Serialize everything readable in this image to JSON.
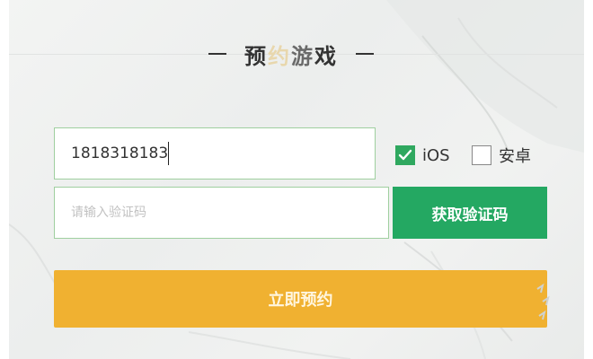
{
  "header": {
    "title_chars": [
      "预",
      "约",
      "游",
      "戏"
    ]
  },
  "form": {
    "phone_value": "1818318183",
    "code_placeholder": "请输入验证码",
    "get_code_label": "获取验证码",
    "reserve_label": "立即预约",
    "platforms": [
      {
        "label": "iOS",
        "checked": true
      },
      {
        "label": "安卓",
        "checked": false
      }
    ]
  },
  "colors": {
    "accent_green": "#24a862",
    "reserve_orange": "#f0b131",
    "input_border": "#9fcf9f"
  },
  "icons": {
    "checkbox_checked": "check-icon"
  }
}
